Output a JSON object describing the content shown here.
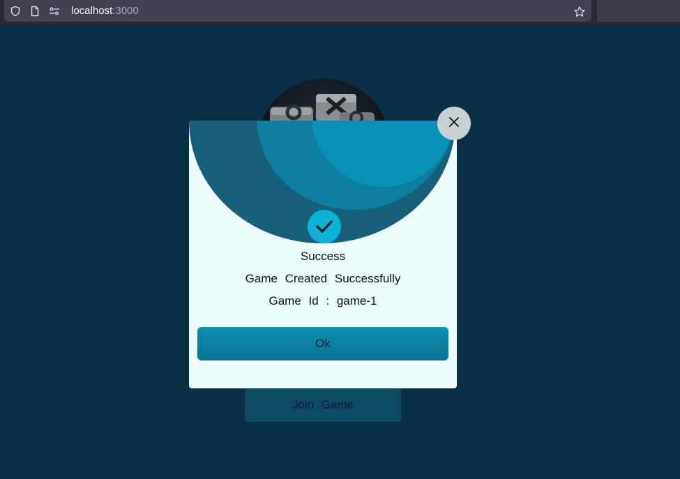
{
  "browser": {
    "url_host": "localhost",
    "url_port": ":3000"
  },
  "page": {
    "join_button_label": "Join Game"
  },
  "modal": {
    "title": "Success",
    "message": "Game Created Successfully",
    "game_id_line": "Game Id : game-1",
    "ok_label": "Ok"
  },
  "colors": {
    "background": "#0b2f45",
    "modal_background": "#edfdfe",
    "accent": "#0bb3d6",
    "button": "#0a8fb2"
  },
  "icons": {
    "shield": "shield-icon",
    "page": "page-icon",
    "site_settings": "site-permissions-icon",
    "bookmark": "star-icon",
    "close": "close-icon",
    "success": "checkmark-icon"
  }
}
